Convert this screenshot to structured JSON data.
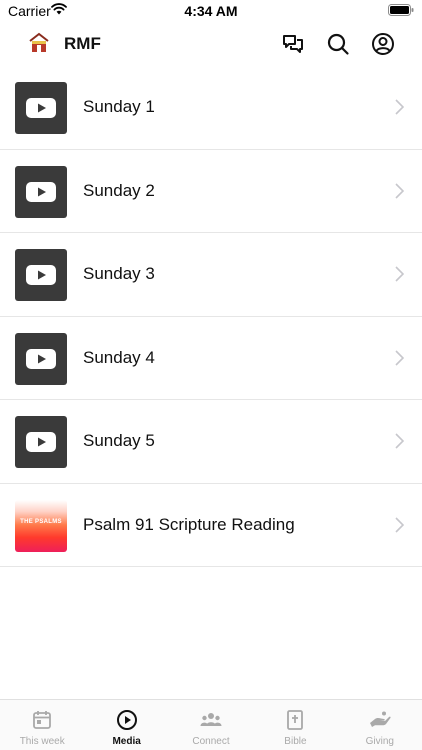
{
  "status_bar": {
    "carrier": "Carrier",
    "time": "4:34 AM"
  },
  "header": {
    "app_name": "RMF",
    "icons": [
      "logo-icon",
      "chat-icon",
      "search-icon",
      "profile-icon"
    ]
  },
  "media": {
    "items": [
      {
        "title": "Sunday 1",
        "thumb": "youtube-icon"
      },
      {
        "title": "Sunday 2",
        "thumb": "youtube-icon"
      },
      {
        "title": "Sunday 3",
        "thumb": "youtube-icon"
      },
      {
        "title": "Sunday 4",
        "thumb": "youtube-icon"
      },
      {
        "title": "Sunday 5",
        "thumb": "youtube-icon"
      },
      {
        "title": "Psalm 91 Scripture Reading",
        "thumb": "psalms-artwork",
        "thumb_text": "THE PSALMS"
      }
    ]
  },
  "tabs": [
    {
      "label": "This week",
      "icon": "calendar-icon",
      "active": false
    },
    {
      "label": "Media",
      "icon": "play-circle-icon",
      "active": true
    },
    {
      "label": "Connect",
      "icon": "people-icon",
      "active": false
    },
    {
      "label": "Bible",
      "icon": "bible-icon",
      "active": false
    },
    {
      "label": "Giving",
      "icon": "giving-hand-icon",
      "active": false
    }
  ],
  "colors": {
    "active_tab": "#111111",
    "inactive_tab": "#a9a9a9",
    "thumb_bg": "#3a3a3a",
    "divider": "#e6e6e6"
  }
}
